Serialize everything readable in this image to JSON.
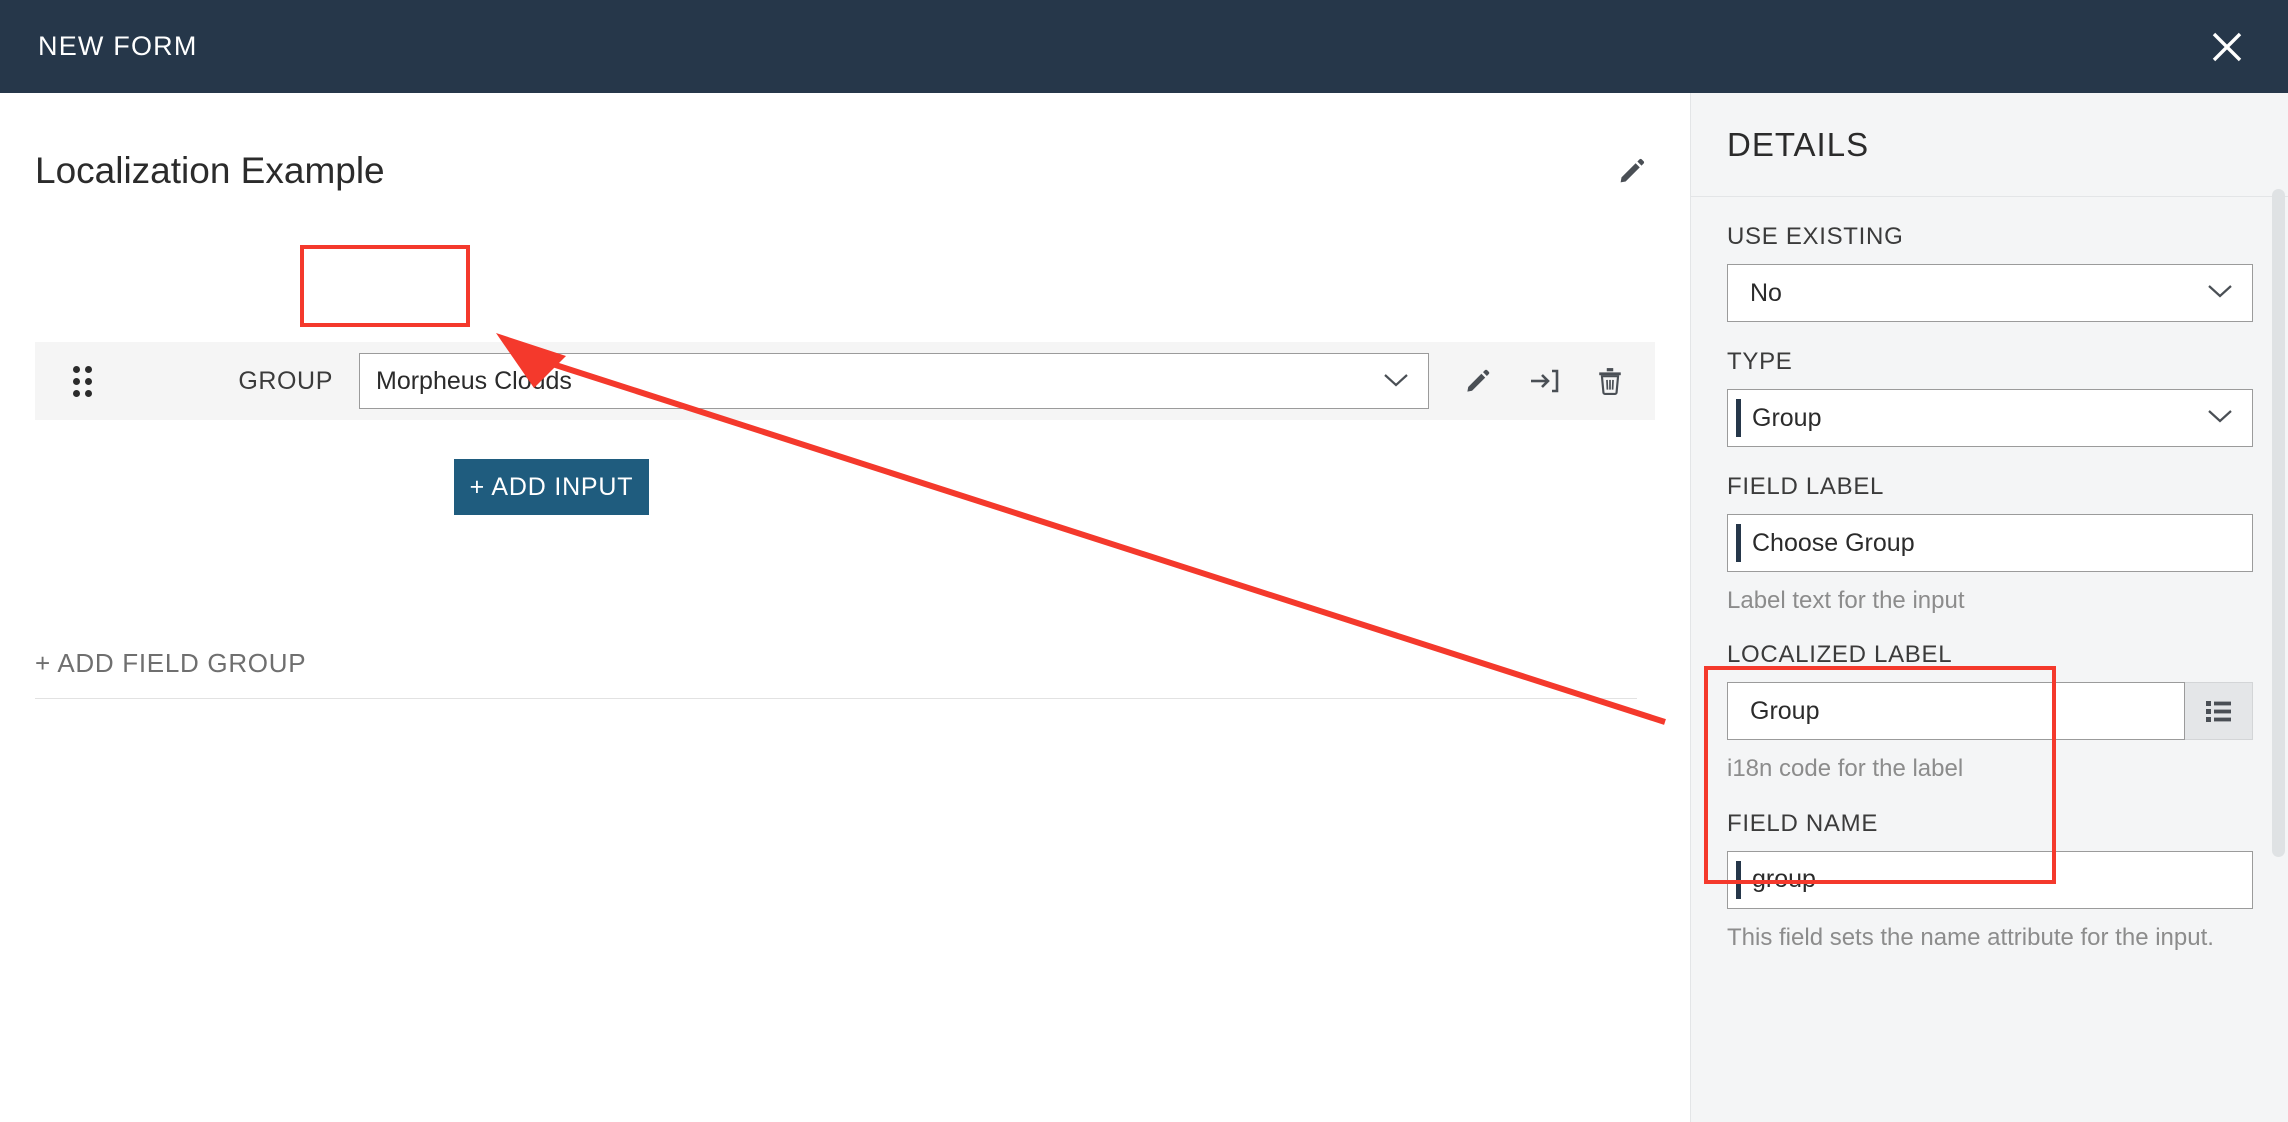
{
  "window": {
    "title": "NEW FORM",
    "close_icon": "close-icon",
    "header_bg": "#26374a"
  },
  "form": {
    "title": "Localization Example",
    "title_edit_icon": "pencil-icon",
    "add_field_group_label": "+ ADD FIELD GROUP",
    "add_input_label": "+ ADD INPUT",
    "add_input_bg": "#1f5c7e",
    "rows": [
      {
        "drag_handle_icon": "drag-handle-icon",
        "label": "GROUP",
        "value": "Morpheus Clouds",
        "dropdown_icon": "chevron-down-icon",
        "actions": [
          {
            "icon": "pencil-icon",
            "name": "edit-input-button"
          },
          {
            "icon": "arrow-into-bracket-icon",
            "name": "move-input-button"
          },
          {
            "icon": "trash-icon",
            "name": "delete-input-button"
          }
        ]
      }
    ]
  },
  "details": {
    "heading": "DETAILS",
    "fields": [
      {
        "label": "USE EXISTING",
        "value": "No",
        "control": "select",
        "accent": false,
        "hint": "",
        "name": "use-existing"
      },
      {
        "label": "TYPE",
        "value": "Group",
        "control": "select",
        "accent": true,
        "hint": "",
        "name": "type"
      },
      {
        "label": "FIELD LABEL",
        "value": "Choose Group",
        "control": "text",
        "accent": true,
        "hint": "Label text for the input",
        "name": "field-label"
      },
      {
        "label": "LOCALIZED LABEL",
        "value": "Group",
        "control": "combo",
        "accent": false,
        "hint": "i18n code for the label",
        "combo_icon": "list-icon",
        "name": "localized-label"
      },
      {
        "label": "FIELD NAME",
        "value": "group",
        "control": "text",
        "accent": true,
        "hint": "This field sets the name attribute for the input.",
        "name": "field-name"
      }
    ]
  },
  "annotations": {
    "highlight_color": "#f4392c",
    "boxes": [
      {
        "target": "group-field-label",
        "label": "GROUP"
      },
      {
        "target": "localized-label-field",
        "label": "LOCALIZED LABEL"
      }
    ],
    "arrow": {
      "from": "localized-label-field",
      "to": "group-field-label"
    }
  }
}
